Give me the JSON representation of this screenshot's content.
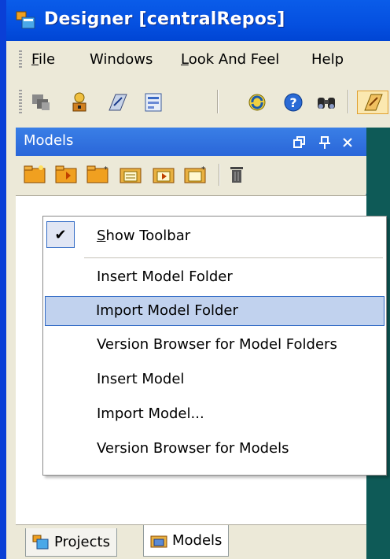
{
  "window": {
    "title": "Designer [centralRepos]"
  },
  "menubar": {
    "items": [
      {
        "label": "File",
        "mnemonic": "F",
        "rest": "ile"
      },
      {
        "label": "Windows",
        "mnemonic": "",
        "rest": "Windows"
      },
      {
        "label": "Look And Feel",
        "mnemonic": "L",
        "rest": "ook And Feel"
      },
      {
        "label": "Help",
        "mnemonic": "",
        "rest": "Help"
      }
    ]
  },
  "toolbar": {
    "icons": [
      "stack-icon",
      "user-lock-icon",
      "models-icon",
      "form-icon",
      "refresh-icon",
      "help-icon",
      "binoculars-icon",
      "open-models-icon"
    ]
  },
  "panel": {
    "title": "Models",
    "header_buttons": [
      "restore-icon",
      "pin-icon",
      "close-icon"
    ],
    "tabs": [
      {
        "label": "Projects",
        "active": false
      },
      {
        "label": "Models",
        "active": true
      }
    ]
  },
  "context_menu": {
    "items": [
      {
        "label": "Show Toolbar",
        "mnemonic": "S",
        "rest": "how Toolbar",
        "checked": true
      },
      {
        "label": "Insert Model Folder"
      },
      {
        "label": "Import Model Folder",
        "highlighted": true
      },
      {
        "label": "Version Browser for Model Folders"
      },
      {
        "label": "Insert Model"
      },
      {
        "label": "Import Model..."
      },
      {
        "label": "Version Browser for Models"
      }
    ]
  },
  "colors": {
    "titlebar": "#0550e0",
    "panel_header": "#2a66d9",
    "highlight": "#c1d2ee",
    "dark_area": "#0e5a57"
  }
}
